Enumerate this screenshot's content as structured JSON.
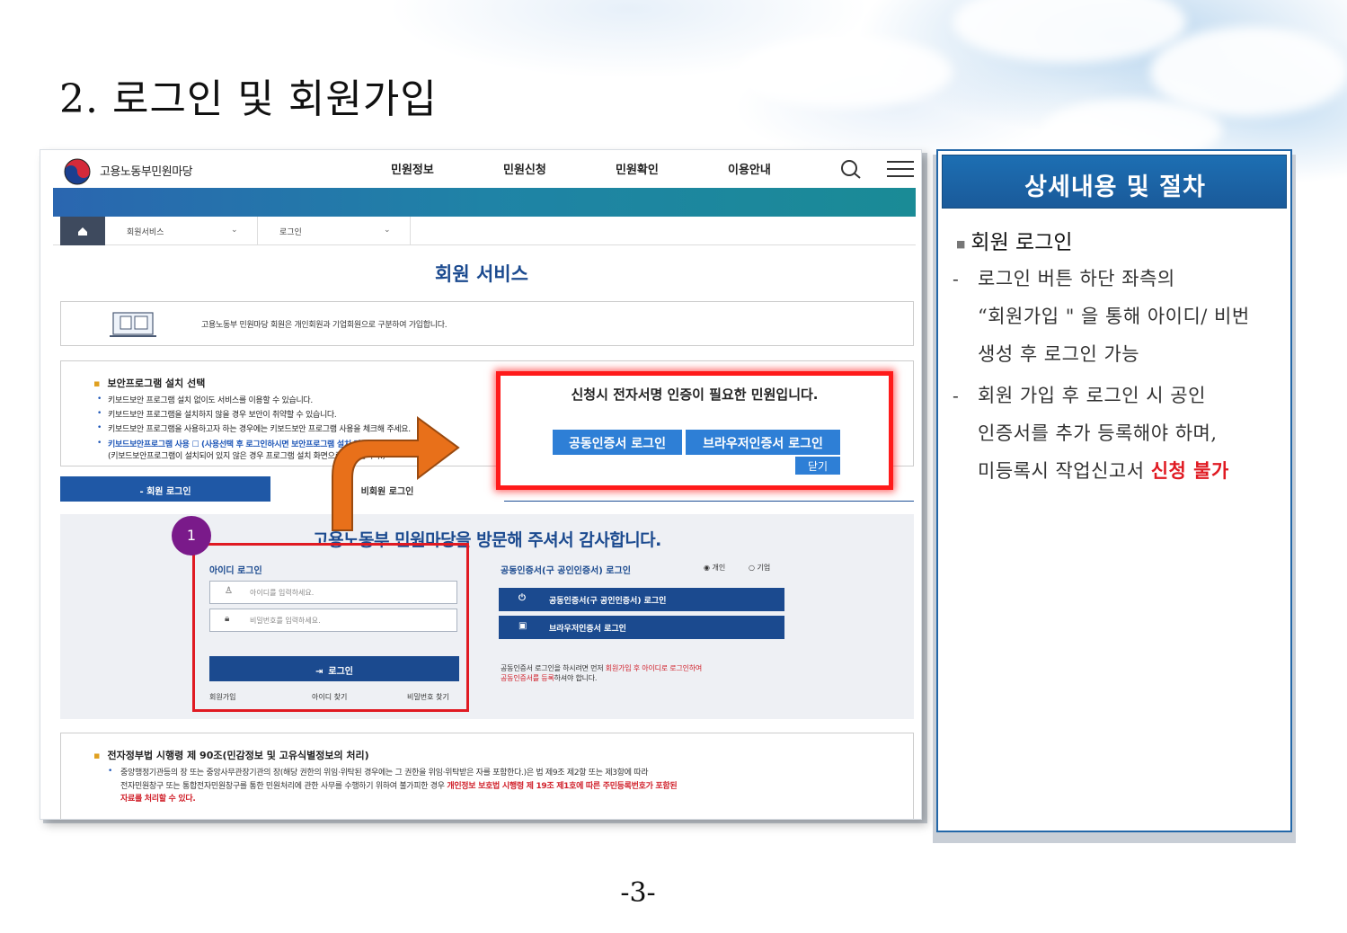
{
  "slide": {
    "title": "2. 로그인 및 회원가입",
    "page_number": "-3-"
  },
  "site": {
    "logo_text": "고용노동부민원마당",
    "nav": [
      "민원정보",
      "민원신청",
      "민원확인",
      "이용안내"
    ],
    "crumbs": [
      "회원서비스",
      "로그인"
    ],
    "heading": "회원 서비스",
    "info_text": "고용노동부 민원마당 회원은 개인회원과 기업회원으로 구분하여 가입합니다.",
    "security": {
      "title": "보안프로그램 설치 선택",
      "lines": [
        "키보드보안 프로그램 설치 없이도 서비스를 이용할 수 있습니다.",
        "키보드보안 프로그램을 설치하지 않을 경우 보안이 취약할 수 있습니다.",
        "키보드보안 프로그램을 사용하고자 하는 경우에는 키보드보안 프로그램 사용을 체크해 주세요.",
        "키보드보안프로그램 사용 ☐ (사용선택 후 로그인하시면 보안프로그램 설치 다른 화면이",
        "(키보드보안프로그램이 설치되어 있지 않은 경우 프로그램 설치 화면으로 이동됩니다.)"
      ]
    },
    "tabs": [
      "- 회원 로그인",
      "비회원 로그인"
    ],
    "welcome": "고용노동부 민원마당을 방문해 주셔서 감사합니다.",
    "id_login": {
      "label": "아이디 로그인",
      "id_placeholder": "아이디를 입력하세요.",
      "pw_placeholder": "비밀번호를 입력하세요.",
      "login_button": "로그인",
      "links": [
        "회원가입",
        "아이디 찾기",
        "비밀번호 찾기"
      ]
    },
    "cert_login": {
      "label": "공동인증서(구 공인인증서) 로그인",
      "radio_personal": "개인",
      "radio_company": "기업",
      "btn_cert": "공동인증서(구 공인인증서) 로그인",
      "btn_browser": "브라우저인증서 로그인",
      "note_1a": "공동인증서 로그인을 하시려면 먼저 ",
      "note_1b": "회원가입 후 아이디로 로그인하여",
      "note_2a": "공동인증서를 등록",
      "note_2b": "하셔야 합니다."
    },
    "law": {
      "title": "전자정부법 시행령 제 90조(민감정보 및 고유식별정보의 처리)",
      "line1": "중앙행정기관등의 장 또는 중앙사무관장기관의 장(해당 권한의 위임·위탁된 경우에는 그 권한을 위임·위탁받은 자를 포함한다.)은 법 제9조 제2항 또는 제3항에 따라",
      "line2a": "전자민원창구 또는 통합전자민원창구를 통한 민원처리에 관한 사무를 수행하기 위하여 불가피한 경우 ",
      "line2b": "개인정보 보호법 시행령 제 19조 제1호에 따른 주민등록번호가 포함된",
      "line3": "자료를 처리할 수 있다."
    }
  },
  "popup": {
    "message": "신청시 전자서명 인증이 필요한 민원입니다.",
    "btn_cert": "공동인증서 로그인",
    "btn_browser": "브라우저인증서 로그인",
    "btn_close": "닫기"
  },
  "step_marker": "1",
  "panel": {
    "header": "상세내용 및 절차",
    "section_title": "회원 로그인",
    "item1": [
      "로그인 버튼 하단 좌측의",
      "“회원가입 \" 을 통해 아이디/ 비번",
      "생성 후 로그인 가능"
    ],
    "item2": [
      "회원 가입 후 로그인 시 공인",
      "인증서를 추가 등록해야 하며,"
    ],
    "item2_last_plain": "미등록시 작업신고서 ",
    "item2_last_red": "신청 불가"
  },
  "colors": {
    "brand_blue": "#1b4a8f",
    "highlight_red": "#e01a22",
    "popup_button_blue": "#2e7fd6",
    "arrow_orange": "#e8701a",
    "step_purple": "#7a1a8a"
  },
  "icons": [
    "home-icon",
    "search-icon",
    "hamburger-menu-icon",
    "user-icon",
    "lock-icon",
    "power-icon",
    "login-icon",
    "document-icon",
    "chevron-down-icon",
    "arrow-icon"
  ]
}
